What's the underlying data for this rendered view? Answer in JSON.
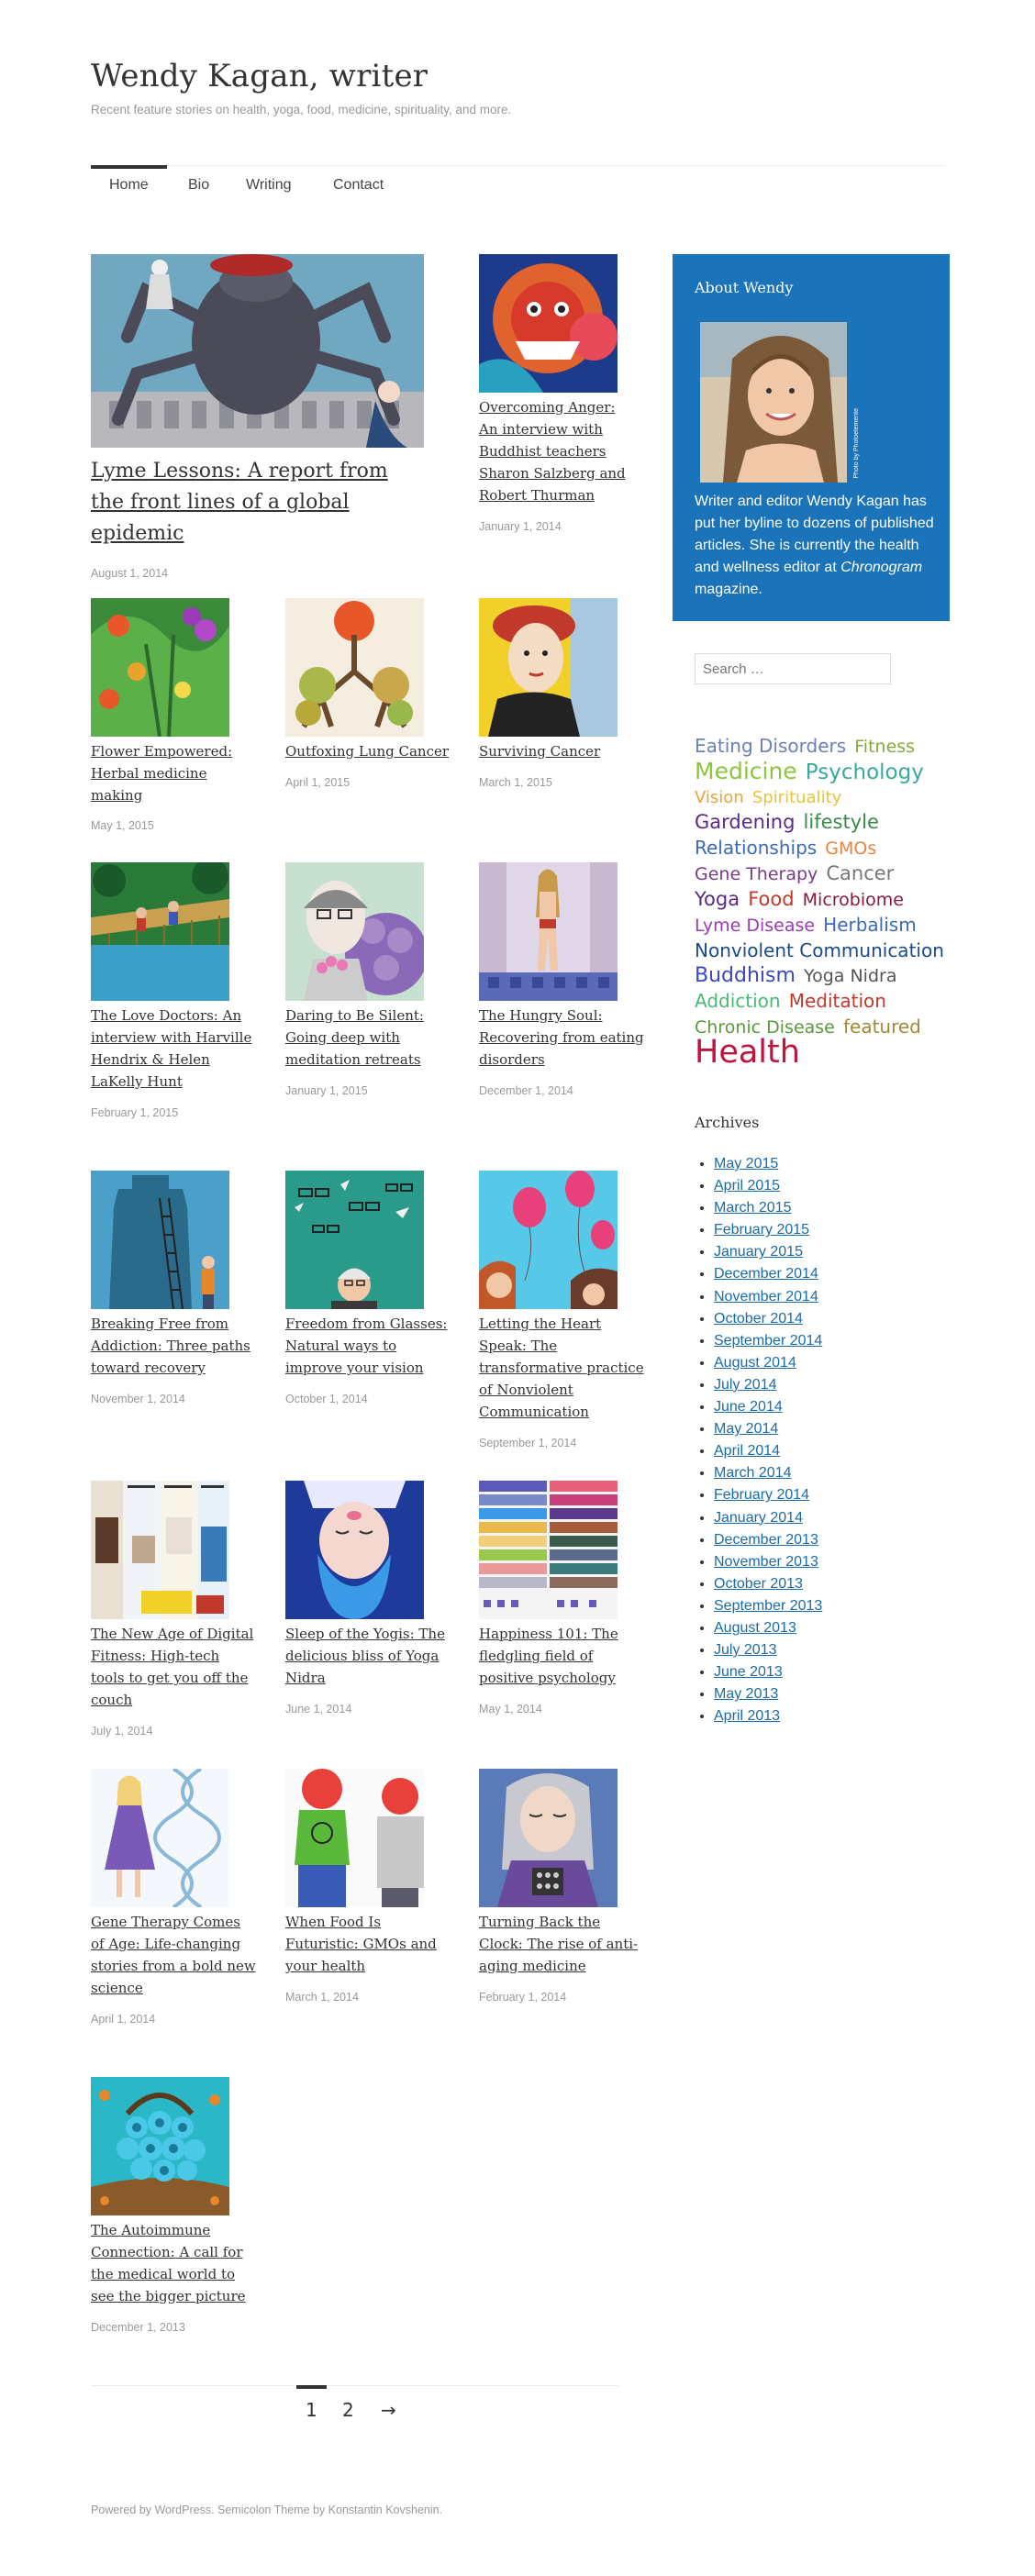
{
  "site": {
    "title": "Wendy Kagan, writer",
    "description": "Recent feature stories on health, yoga, food, medicine, spirituality, and more."
  },
  "nav": [
    "Home",
    "Bio",
    "Writing",
    "Contact"
  ],
  "posts": [
    {
      "title": "Lyme Lessons: A report from the front lines of a global epidemic",
      "date": "August 1, 2014"
    },
    {
      "title": "Overcoming Anger: An interview with Buddhist teachers Sharon Salzberg and Robert Thurman",
      "date": "January 1, 2014"
    },
    {
      "title": "Flower Empowered: Herbal medicine making",
      "date": "May 1, 2015"
    },
    {
      "title": "Outfoxing Lung Cancer",
      "date": "April 1, 2015"
    },
    {
      "title": "Surviving Cancer",
      "date": "March 1, 2015"
    },
    {
      "title": "The Love Doctors: An interview with Harville Hendrix & Helen LaKelly Hunt",
      "date": "February 1, 2015"
    },
    {
      "title": "Daring to Be Silent: Going deep with meditation retreats",
      "date": "January 1, 2015"
    },
    {
      "title": "The Hungry Soul: Recovering from eating disorders",
      "date": "December 1, 2014"
    },
    {
      "title": "Breaking Free from Addiction: Three paths toward recovery",
      "date": "November 1, 2014"
    },
    {
      "title": "Freedom from Glasses: Natural ways to improve your vision",
      "date": "October 1, 2014"
    },
    {
      "title": "Letting the Heart Speak: The transformative practice of Nonviolent Communication",
      "date": "September 1, 2014"
    },
    {
      "title": "The New Age of Digital Fitness: High-tech tools to get you off the couch",
      "date": "July 1, 2014"
    },
    {
      "title": "Sleep of the Yogis: The delicious bliss of Yoga Nidra",
      "date": "June 1, 2014"
    },
    {
      "title": "Happiness 101: The fledgling field of positive psychology",
      "date": "May 1, 2014"
    },
    {
      "title": "Gene Therapy Comes of Age: Life-changing stories from a bold new science",
      "date": "April 1, 2014"
    },
    {
      "title": "When Food Is Futuristic: GMOs and your health",
      "date": "March 1, 2014"
    },
    {
      "title": "Turning Back the Clock: The rise of anti-aging medicine",
      "date": "February 1, 2014"
    },
    {
      "title": "The Autoimmune Connection: A call for the medical world to see the bigger picture",
      "date": "December 1, 2013"
    }
  ],
  "about": {
    "title": "About Wendy",
    "photo_credit": "Photo by Photoelemente",
    "text_before": "Writer and editor Wendy Kagan has put her byline to dozens of published articles. She is currently the health and wellness editor at ",
    "magazine": "Chronogram",
    "text_after": " magazine."
  },
  "search": {
    "placeholder": "Search …"
  },
  "tags": [
    {
      "label": "Eating Disorders",
      "color": "#6b7fb8",
      "size": 20
    },
    {
      "label": "Fitness",
      "color": "#8aa83a",
      "size": 19
    },
    {
      "label": "Medicine",
      "color": "#8cc63f",
      "size": 25
    },
    {
      "label": "Psychology",
      "color": "#3aaa9a",
      "size": 23
    },
    {
      "label": "Vision",
      "color": "#e8a33c",
      "size": 18
    },
    {
      "label": "Spirituality",
      "color": "#e8c33c",
      "size": 18
    },
    {
      "label": "Gardening",
      "color": "#5b2a86",
      "size": 21
    },
    {
      "label": "lifestyle",
      "color": "#3a8a4a",
      "size": 21
    },
    {
      "label": "Relationships",
      "color": "#3a6ab8",
      "size": 20
    },
    {
      "label": "GMOs",
      "color": "#e8843c",
      "size": 19
    },
    {
      "label": "Gene Therapy",
      "color": "#7a3a8a",
      "size": 19
    },
    {
      "label": "Cancer",
      "color": "#777777",
      "size": 21
    },
    {
      "label": "Yoga",
      "color": "#5b2a86",
      "size": 21
    },
    {
      "label": "Food",
      "color": "#c0392b",
      "size": 21
    },
    {
      "label": "Microbiome",
      "color": "#8a1a3a",
      "size": 19
    },
    {
      "label": "Lyme Disease",
      "color": "#9b3ab8",
      "size": 19
    },
    {
      "label": "Herbalism",
      "color": "#3a6ab8",
      "size": 20
    },
    {
      "label": "Nonviolent Communication",
      "color": "#1a4a8a",
      "size": 20
    },
    {
      "label": "Buddhism",
      "color": "#3a4ab8",
      "size": 22
    },
    {
      "label": "Yoga Nidra",
      "color": "#555555",
      "size": 19
    },
    {
      "label": "Addiction",
      "color": "#4ab878",
      "size": 20
    },
    {
      "label": "Meditation",
      "color": "#c0392b",
      "size": 20
    },
    {
      "label": "Chronic Disease",
      "color": "#5a9a3a",
      "size": 19
    },
    {
      "label": "featured",
      "color": "#a08a3a",
      "size": 20
    },
    {
      "label": "Health",
      "color": "#c0143c",
      "size": 35
    }
  ],
  "archives": {
    "title": "Archives",
    "items": [
      "May 2015",
      "April 2015",
      "March 2015",
      "February 2015",
      "January 2015",
      "December 2014",
      "November 2014",
      "October 2014",
      "September 2014",
      "August 2014",
      "July 2014",
      "June 2014",
      "May 2014",
      "April 2014",
      "March 2014",
      "February 2014",
      "January 2014",
      "December 2013",
      "November 2013",
      "October 2013",
      "September 2013",
      "August 2013",
      "July 2013",
      "June 2013",
      "May 2013",
      "April 2013"
    ]
  },
  "pagination": {
    "page1": "1",
    "page2": "2",
    "next": "→"
  },
  "footer": "Powered by WordPress. Semicolon Theme by Konstantin Kovshenin."
}
